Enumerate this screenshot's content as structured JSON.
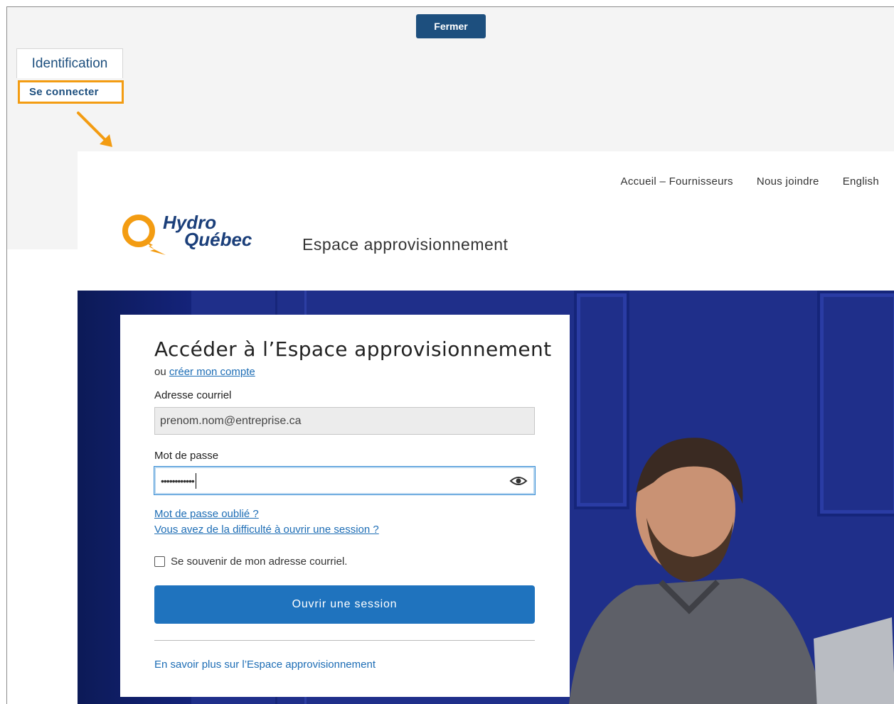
{
  "overlay": {
    "close_label": "Fermer",
    "tab_label": "Identification",
    "connect_label": "Se connecter",
    "highlight_color": "#f39c12"
  },
  "site": {
    "nav": [
      "Accueil – Fournisseurs",
      "Nous joindre",
      "English"
    ],
    "logo": {
      "line1": "Hydro",
      "line2": "Québec",
      "brand_color": "#1b3f7a",
      "accent_color": "#f39c12"
    },
    "section_title": "Espace approvisionnement"
  },
  "login": {
    "title": "Accéder à l’Espace approvisionnement",
    "or_text": "ou",
    "create_account": "créer mon compte",
    "email_label": "Adresse courriel",
    "email_value": "prenom.nom@entreprise.ca",
    "password_label": "Mot de passe",
    "password_value": "••••••••••••",
    "show_password_icon": "eye-icon",
    "forgot_password": "Mot de passe oublié ?",
    "trouble_link": "Vous avez de la difficulté à ouvrir une session ?",
    "remember_label": "Se souvenir de mon adresse courriel.",
    "remember_checked": false,
    "submit_label": "Ouvrir une session",
    "learn_more": "En savoir plus sur l’Espace approvisionnement",
    "button_color": "#1f73be",
    "link_color": "#1d6db5"
  }
}
